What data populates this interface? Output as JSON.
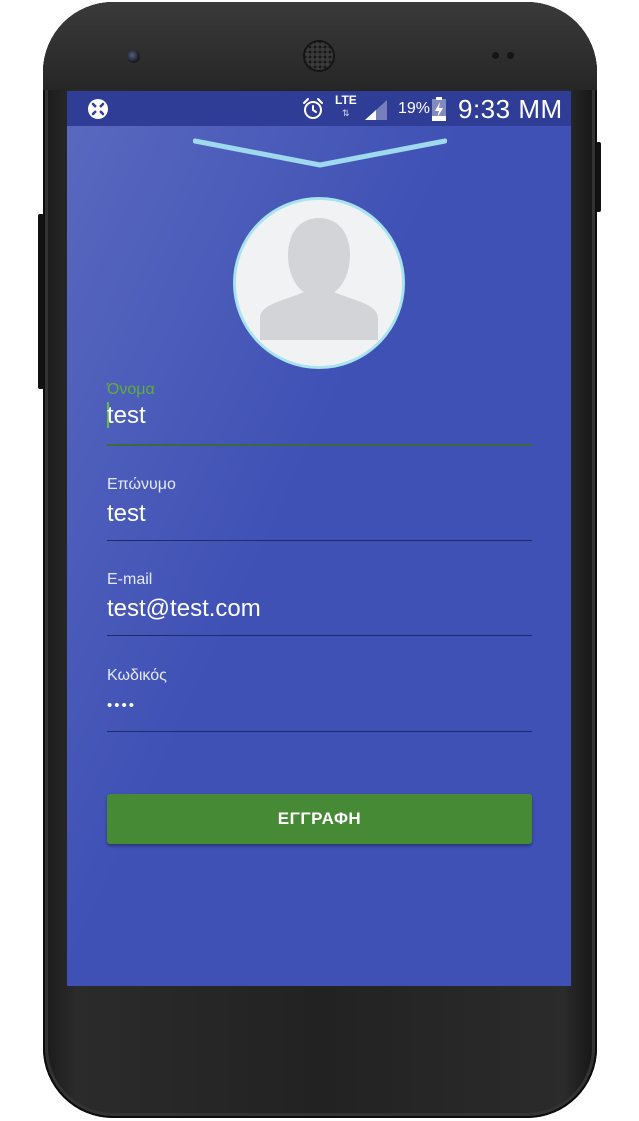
{
  "status_bar": {
    "network_type": "LTE",
    "network_arrows": "⇅",
    "battery_percent": "19%",
    "time": "9:33 MM",
    "icons": [
      "app-notification-icon",
      "alarm-icon",
      "cell-signal-icon",
      "battery-charging-icon"
    ]
  },
  "form": {
    "first_name": {
      "label": "Όνομα",
      "value": "test"
    },
    "last_name": {
      "label": "Επώνυμο",
      "value": "test"
    },
    "email": {
      "label": "E-mail",
      "value": "test@test.com"
    },
    "password": {
      "label": "Κωδικός",
      "value": "••••"
    }
  },
  "register_button": {
    "label": "ΕΓΓΡΑΦΗ"
  },
  "colors": {
    "screen_background": "#3f51b5",
    "status_bar": "#2f3d96",
    "button": "#468a35",
    "focus_accent": "#5fae3a",
    "avatar_ring": "#a8e3f0"
  }
}
